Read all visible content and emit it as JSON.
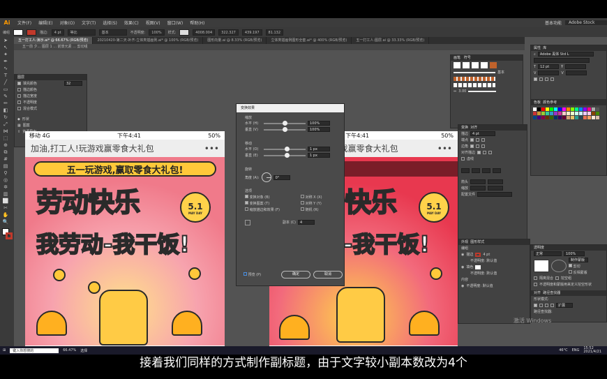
{
  "menu": {
    "logo": "Ai",
    "items": [
      "文件(F)",
      "编辑(E)",
      "对象(O)",
      "文字(T)",
      "选择(S)",
      "效果(C)",
      "视图(V)",
      "窗口(W)",
      "帮助(H)"
    ],
    "workspace": "基本功能",
    "search_placeholder": "Adobe Stock"
  },
  "control_bar": {
    "label": "编组",
    "stroke_label": "描边:",
    "stroke_value": "4 pt",
    "style1": "等比",
    "style2": "基本",
    "opacity_label": "不透明度:",
    "opacity_value": "100%",
    "style_label": "样式:",
    "x": "4008.004",
    "y": "322.327",
    "w": "439.197",
    "h": "81.132"
  },
  "tabs": [
    "五一打工人:演示.ai* @ 66.67% (RGB/预览)",
    "20210420-第二天-补齐-立体类插画例.ai* @ 100% (RGB/预览)",
    "图形向量.ai @ 8.33% (RGB/预览)",
    "立体类插画例图形全套.ai* @ 400% (RGB/预览)",
    "五一打工人:图层.ai @ 33.33% (RGB/预览)"
  ],
  "breadcrumb": "五一前 夕... 图层 1 ... 前景元素 ... 剪切组",
  "left_panel": {
    "title": "图层",
    "rows": [
      {
        "label": "填充颜色",
        "value": "32",
        "checked": true
      },
      {
        "label": "描边颜色",
        "value": "",
        "checked": false
      },
      {
        "label": "描边宽度",
        "value": "",
        "checked": false
      },
      {
        "label": "不透明度",
        "value": "",
        "checked": false
      },
      {
        "label": "混合模式",
        "value": "",
        "checked": false
      }
    ],
    "items": [
      "形状",
      "图案",
      "资源导出"
    ]
  },
  "phone_left": {
    "carrier": "移动 4G",
    "time": "下午4:41",
    "battery": "50%",
    "nav_title": "加油,打工人!玩游戏赢零食大礼包",
    "nav_more": "•••",
    "banner": "五一玩游戏,赢取零食大礼包!",
    "title1": "劳动快乐",
    "title2": "我劳动-我干饭!",
    "badge": "5.1",
    "badge_small": "MAY DAY"
  },
  "phone_right": {
    "time": "下午4:41",
    "battery": "50%",
    "nav_title": "加油,打工人!玩游戏赢零食大礼包",
    "nav_more": "•••",
    "title1": "快乐",
    "title2": "我劳动-我干饭!",
    "badge": "5.1",
    "badge_small": "MAY DAY"
  },
  "dialog": {
    "title": "变换效果",
    "scale_header": "缩放",
    "scale_h_label": "水平 (H)",
    "scale_h": "100%",
    "scale_v_label": "垂直 (V)",
    "scale_v": "100%",
    "move_header": "移动",
    "move_h_label": "水平 (O)",
    "move_h": "1 px",
    "move_v_label": "垂直 (E)",
    "move_v": "1 px",
    "rotate_header": "旋转",
    "angle_label": "角度 (A):",
    "angle": "0°",
    "options_header": "选项",
    "opt_transform_obj": "变换对象 (B)",
    "opt_transform_pattern": "变换图案 (T)",
    "opt_scale_stroke": "缩放描边和效果 (F)",
    "opt_mirror_x": "对称 X (X)",
    "opt_mirror_y": "对称 Y (Y)",
    "opt_random": "随机 (R)",
    "copies_label": "副本 (C)",
    "copies": "4",
    "preview_label": "预览 (P)",
    "ok": "确定",
    "cancel": "取消"
  },
  "right_panels": {
    "brush_title": "画笔",
    "symbol_title": "符号",
    "brush_value": "3.00",
    "brush_label": "基本",
    "transform_tabs": [
      "变换",
      "对齐"
    ],
    "stroke_label": "描边",
    "stroke_weight": "4 pt",
    "miter_label": "尖角",
    "ending_label": "端点",
    "corner_label": "边角",
    "align_label": "对齐描边",
    "dash_label": "虚线",
    "arrow_label": "箭头",
    "scale_label": "缩放",
    "profile_label": "配置文件",
    "appearance_title": "外观",
    "graphic_style_title": "图形样式",
    "appearance_rows": [
      "编组",
      "描边",
      "4 pt",
      "不透明度: 默认值",
      "填色",
      "不透明度: 默认值",
      "内容",
      "不透明度: 默认值"
    ],
    "properties_title": "属性",
    "properties_tab": "库",
    "props_font": "Adobe 黑体 Std L",
    "props_size": "12 pt",
    "color_title": "色板",
    "color_ref": "颜色参考",
    "transparency_title": "透明度",
    "transparency_mode": "正常",
    "transparency_opacity": "100%",
    "make_mask": "制作蒙版",
    "clip": "剪切",
    "invert_mask": "反相蒙版",
    "isolate": "隔离混合",
    "knockout": "挖空组",
    "opacity_mask": "不透明度和蒙版用来定义挖空形状",
    "pathfinder_title": "路径查找器",
    "pathfinder_tab": "对齐",
    "shape_modes": "形状模式:",
    "pathfinders": "路径查找器:",
    "expand": "扩展",
    "swatches": [
      "#ffffff",
      "#000000",
      "#ff0000",
      "#ffff00",
      "#00ff00",
      "#00ffff",
      "#0000ff",
      "#ff00ff",
      "#ff8800",
      "#88ff00",
      "#00ff88",
      "#0088ff",
      "#8800ff",
      "#ff0088",
      "#aaaaaa",
      "#555555",
      "#cc3333",
      "#cc9933",
      "#99cc33",
      "#33cc99",
      "#3399cc",
      "#9933cc",
      "#cc3399",
      "#ffcccc",
      "#ffeecc",
      "#eeffcc",
      "#ccffee",
      "#cceeff",
      "#eeccff",
      "#ffccee",
      "#884400",
      "#448800",
      "#004488",
      "#440088",
      "#880044",
      "#663300",
      "#336600",
      "#003366",
      "#330066",
      "#660033",
      "#d4a373",
      "#e9c46a",
      "#2a9d8f",
      "#264653",
      "#e76f51",
      "#f4a261",
      "#ffe8d6",
      "#ddbea9"
    ]
  },
  "watermark": "激活 Windows",
  "taskbar": {
    "search": "键入你想搜的",
    "status_left": "66.47%",
    "select_label": "选择",
    "weather": "46°C",
    "lang": "ENG",
    "time": "15:52",
    "date": "2021/4/21"
  },
  "subtitle": "接着我们同样的方式制作副标题，由于文字较小副本数改为4个",
  "colors": {
    "poster_bg_left": "#f07a8a",
    "poster_bg_right": "#e8384f",
    "poster_yellow": "#ffc83a",
    "app_bg": "#535353"
  }
}
